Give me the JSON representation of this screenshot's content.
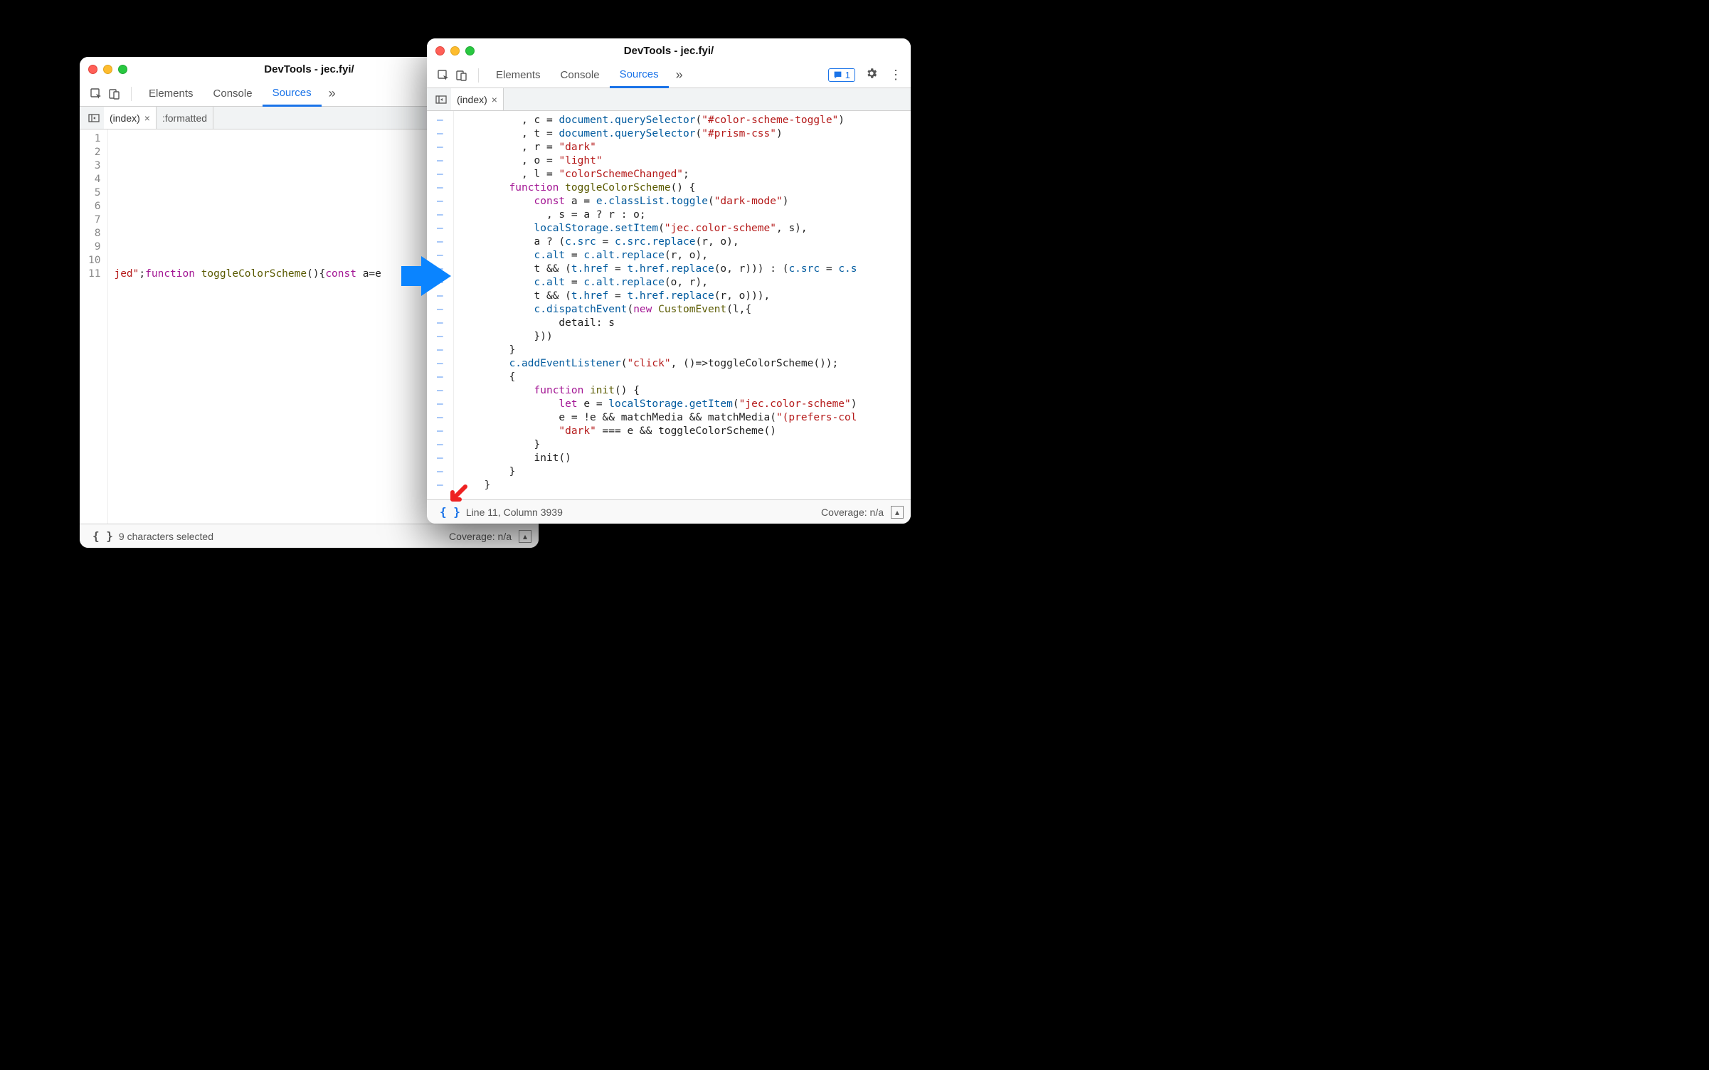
{
  "windowLeft": {
    "title": "DevTools - jec.fyi/",
    "tabs": [
      "Elements",
      "Console",
      "Sources"
    ],
    "activeTab": "Sources",
    "fileTabs": {
      "index": "(index)",
      "formatted": ":formatted"
    },
    "lineNumbers": "1\n2\n3\n4\n5\n6\n7\n8\n9\n10\n11",
    "line11_frag1": "jed\"",
    "line11_frag2": ";",
    "line11_kw1": "function",
    "line11_fn": " toggleColorScheme",
    "line11_frag3": "(){",
    "line11_kw2": "const",
    "line11_frag4": " a=e",
    "status": "9 characters selected",
    "coverage": "Coverage: n/a"
  },
  "windowRight": {
    "title": "DevTools - jec.fyi/",
    "tabs": [
      "Elements",
      "Console",
      "Sources"
    ],
    "activeTab": "Sources",
    "msgCount": "1",
    "fileTabs": {
      "index": "(index)"
    },
    "gutterDashes": "–\n–\n–\n–\n–\n–\n–\n–\n–\n–\n–\n–\n–\n–\n–\n–\n–\n–\n–\n–\n–\n–\n–\n–\n–\n–\n–\n–",
    "code": {
      "l1": {
        "pre": "          , ",
        "v": "c",
        "mid": " = ",
        "ident": "document.querySelector",
        "paren": "(",
        "str": "\"#color-scheme-toggle\"",
        "end": ")"
      },
      "l2": {
        "pre": "          , ",
        "v": "t",
        "mid": " = ",
        "ident": "document.querySelector",
        "paren": "(",
        "str": "\"#prism-css\"",
        "end": ")"
      },
      "l3": {
        "pre": "          , ",
        "v": "r",
        "mid": " = ",
        "str": "\"dark\""
      },
      "l4": {
        "pre": "          , ",
        "v": "o",
        "mid": " = ",
        "str": "\"light\""
      },
      "l5": {
        "pre": "          , ",
        "v": "l",
        "mid": " = ",
        "str": "\"colorSchemeChanged\"",
        "end": ";"
      },
      "l6": {
        "pre": "        ",
        "kw": "function",
        "fn": " toggleColorScheme",
        "end": "() {"
      },
      "l7": {
        "pre": "            ",
        "kw": "const",
        "mid": " a = ",
        "ident": "e.classList.toggle",
        "paren": "(",
        "str": "\"dark-mode\"",
        "end": ")"
      },
      "l8": "              , s = a ? r : o;",
      "l9": {
        "pre": "            ",
        "ident": "localStorage.setItem",
        "paren": "(",
        "str": "\"jec.color-scheme\"",
        "end": ", s),"
      },
      "l10": {
        "pre": "            a ? (",
        "ident": "c.src",
        "mid": " = ",
        "ident2": "c.src.replace",
        "end": "(r, o),"
      },
      "l11": {
        "pre": "            ",
        "ident": "c.alt",
        "mid": " = ",
        "ident2": "c.alt.replace",
        "end": "(r, o),"
      },
      "l12": {
        "pre": "            t && (",
        "ident": "t.href",
        "mid": " = ",
        "ident2": "t.href.replace",
        "end": "(o, r))) : (",
        "ident3": "c.src",
        "mid2": " = ",
        "ident4": "c.s"
      },
      "l13": {
        "pre": "            ",
        "ident": "c.alt",
        "mid": " = ",
        "ident2": "c.alt.replace",
        "end": "(o, r),"
      },
      "l14": {
        "pre": "            t && (",
        "ident": "t.href",
        "mid": " = ",
        "ident2": "t.href.replace",
        "end": "(r, o))),"
      },
      "l15": {
        "pre": "            ",
        "ident": "c.dispatchEvent",
        "paren": "(",
        "kw": "new",
        "fn": " CustomEvent",
        "end": "(l,{"
      },
      "l16": "                detail: s",
      "l17": "            }))",
      "l18": "        }",
      "l19": {
        "pre": "        ",
        "ident": "c.addEventListener",
        "paren": "(",
        "str": "\"click\"",
        "end": ", ()=>toggleColorScheme());"
      },
      "l20": "        {",
      "l21": {
        "pre": "            ",
        "kw": "function",
        "fn": " init",
        "end": "() {"
      },
      "l22": {
        "pre": "                ",
        "kw": "let",
        "mid": " e = ",
        "ident": "localStorage.getItem",
        "paren": "(",
        "str": "\"jec.color-scheme\"",
        "end": ")"
      },
      "l23": {
        "pre": "                e = !e && matchMedia && matchMedia(",
        "str": "\"(prefers-col"
      },
      "l24": {
        "pre": "                ",
        "str": "\"dark\"",
        "end": " === e && toggleColorScheme()"
      },
      "l25": "            }",
      "l26": "            init()",
      "l27": "        }",
      "l28": "    }"
    },
    "status": "Line 11, Column 3939",
    "coverage": "Coverage: n/a"
  }
}
